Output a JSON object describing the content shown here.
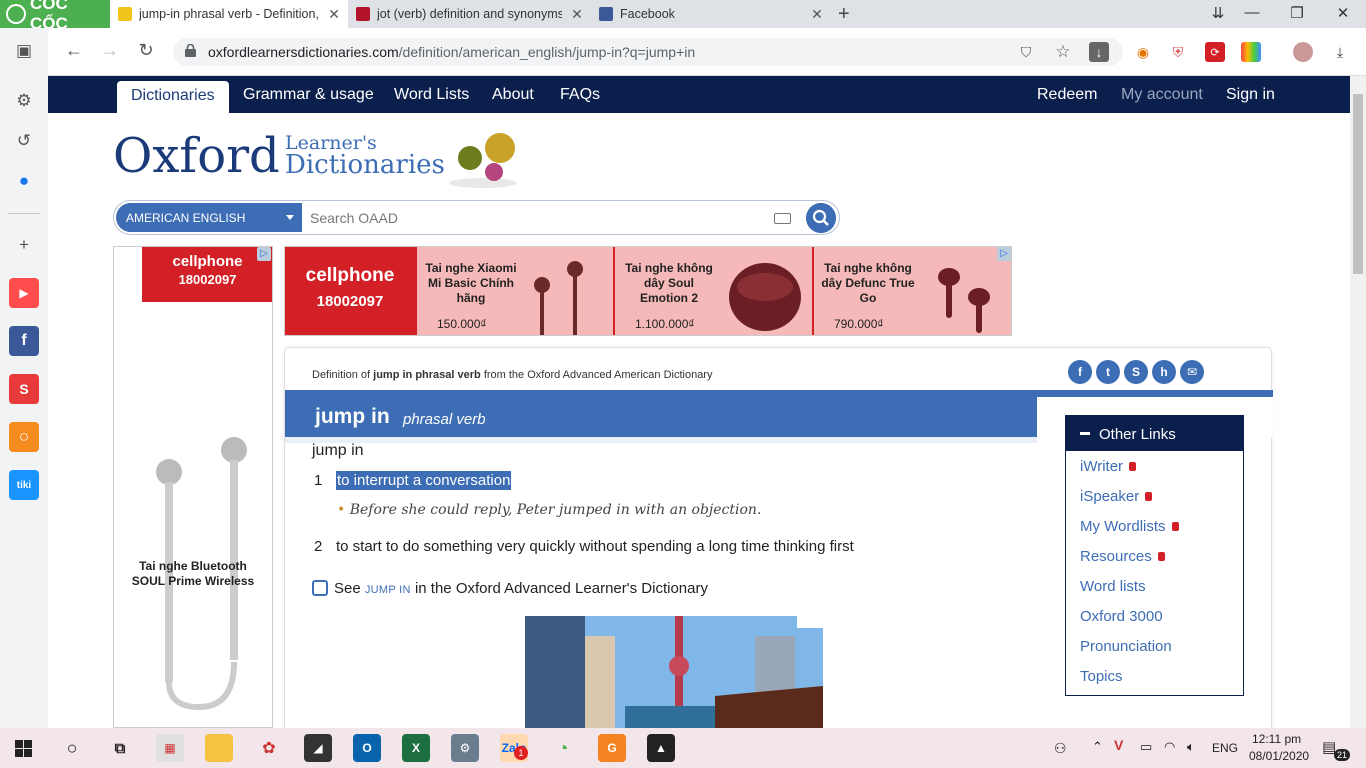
{
  "browser": {
    "brand": "CỐC CỐC",
    "tabs": [
      {
        "title": "jump-in phrasal verb - Definition, p"
      },
      {
        "title": "jot (verb) definition and synonyms"
      },
      {
        "title": "Facebook"
      }
    ],
    "url_domain": "oxfordlearnersdictionaries.com",
    "url_path": "/definition/american_english/jump-in?q=jump+in"
  },
  "site": {
    "nav": [
      "Dictionaries",
      "Grammar & usage",
      "Word Lists",
      "About",
      "FAQs"
    ],
    "nav_right": [
      "Redeem",
      "My account",
      "Sign in"
    ],
    "logo_main": "Oxford",
    "logo_line1": "Learner's",
    "logo_line2": "Dictionaries",
    "dialect": "AMERICAN ENGLISH",
    "search_placeholder": "Search OAAD"
  },
  "ads": {
    "brand": "cellphone",
    "phone": "18002097",
    "left_product": "Tai nghe Bluetooth SOUL Prime Wireless",
    "banner": [
      {
        "name": "Tai nghe Xiaomi Mi Basic Chính hãng",
        "price": "150.000₫"
      },
      {
        "name": "Tai nghe không dây Soul Emotion 2",
        "price": "1.100.000₫"
      },
      {
        "name": "Tai nghe không dây Defunc True Go",
        "price": "790.000₫"
      }
    ]
  },
  "entry": {
    "crumb_pre": "Definition of",
    "crumb_word": "jump in phrasal verb",
    "crumb_post": "from the Oxford Advanced American Dictionary",
    "headword": "jump in",
    "pos": "phrasal verb",
    "def_headword": "jump in",
    "senses": [
      {
        "num": "1",
        "text": "to interrupt a conversation"
      },
      {
        "num": "2",
        "text": "to start to do something very quickly without spending a long time thinking first"
      }
    ],
    "example": "Before she could reply, Peter jumped in with an objection.",
    "see_pre": "See",
    "see_word": "JUMP IN",
    "see_post": "in the Oxford Advanced Learner's Dictionary"
  },
  "other_links": {
    "title": "Other Links",
    "items": [
      "iWriter",
      "iSpeaker",
      "My Wordlists",
      "Resources",
      "Word lists",
      "Oxford 3000",
      "Pronunciation",
      "Topics"
    ]
  },
  "taskbar": {
    "language": "ENG",
    "time": "12:11 pm",
    "date": "08/01/2020",
    "notifications": "21"
  }
}
